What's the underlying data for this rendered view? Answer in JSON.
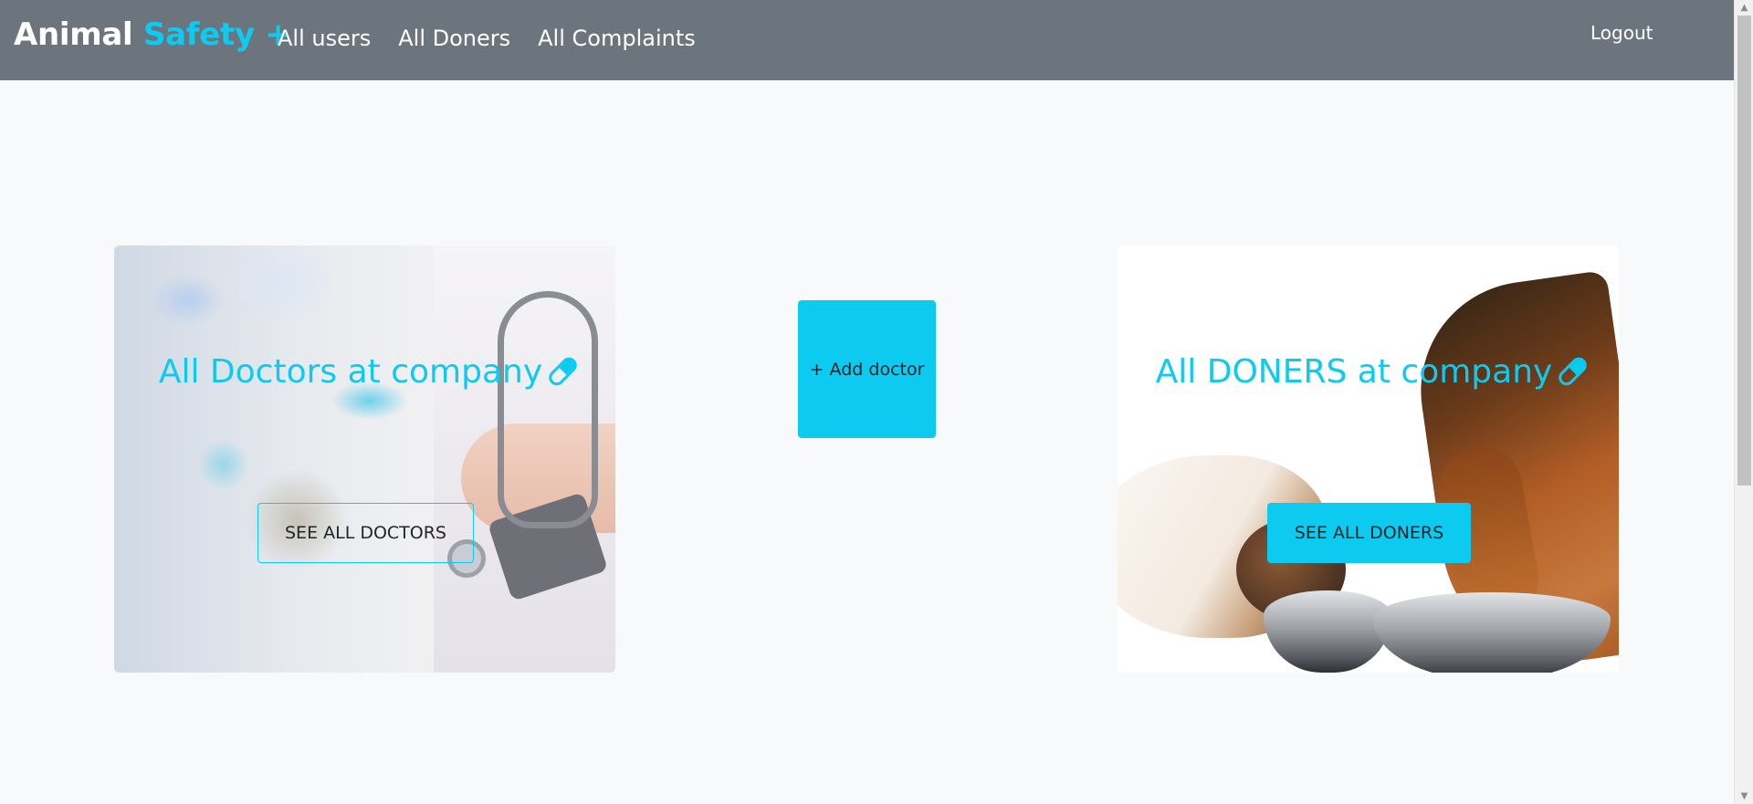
{
  "navbar": {
    "brand_main": "Animal",
    "brand_accent": "Safety +",
    "links": [
      {
        "label": "All users"
      },
      {
        "label": "All Doners"
      },
      {
        "label": "All Complaints"
      }
    ],
    "logout_label": "Logout"
  },
  "cards": {
    "doctors": {
      "title": "All Doctors at company",
      "button_label": "SEE ALL DOCTORS",
      "icon": "pill-icon"
    },
    "doners": {
      "title": "All DONERS at company",
      "button_label": "SEE ALL DONERS",
      "icon": "pill-icon"
    }
  },
  "add_doctor_label": "+ Add doctor",
  "colors": {
    "navbar_bg": "#6c757d",
    "accent": "#0dcaf0",
    "page_bg": "#f8f9fa"
  }
}
